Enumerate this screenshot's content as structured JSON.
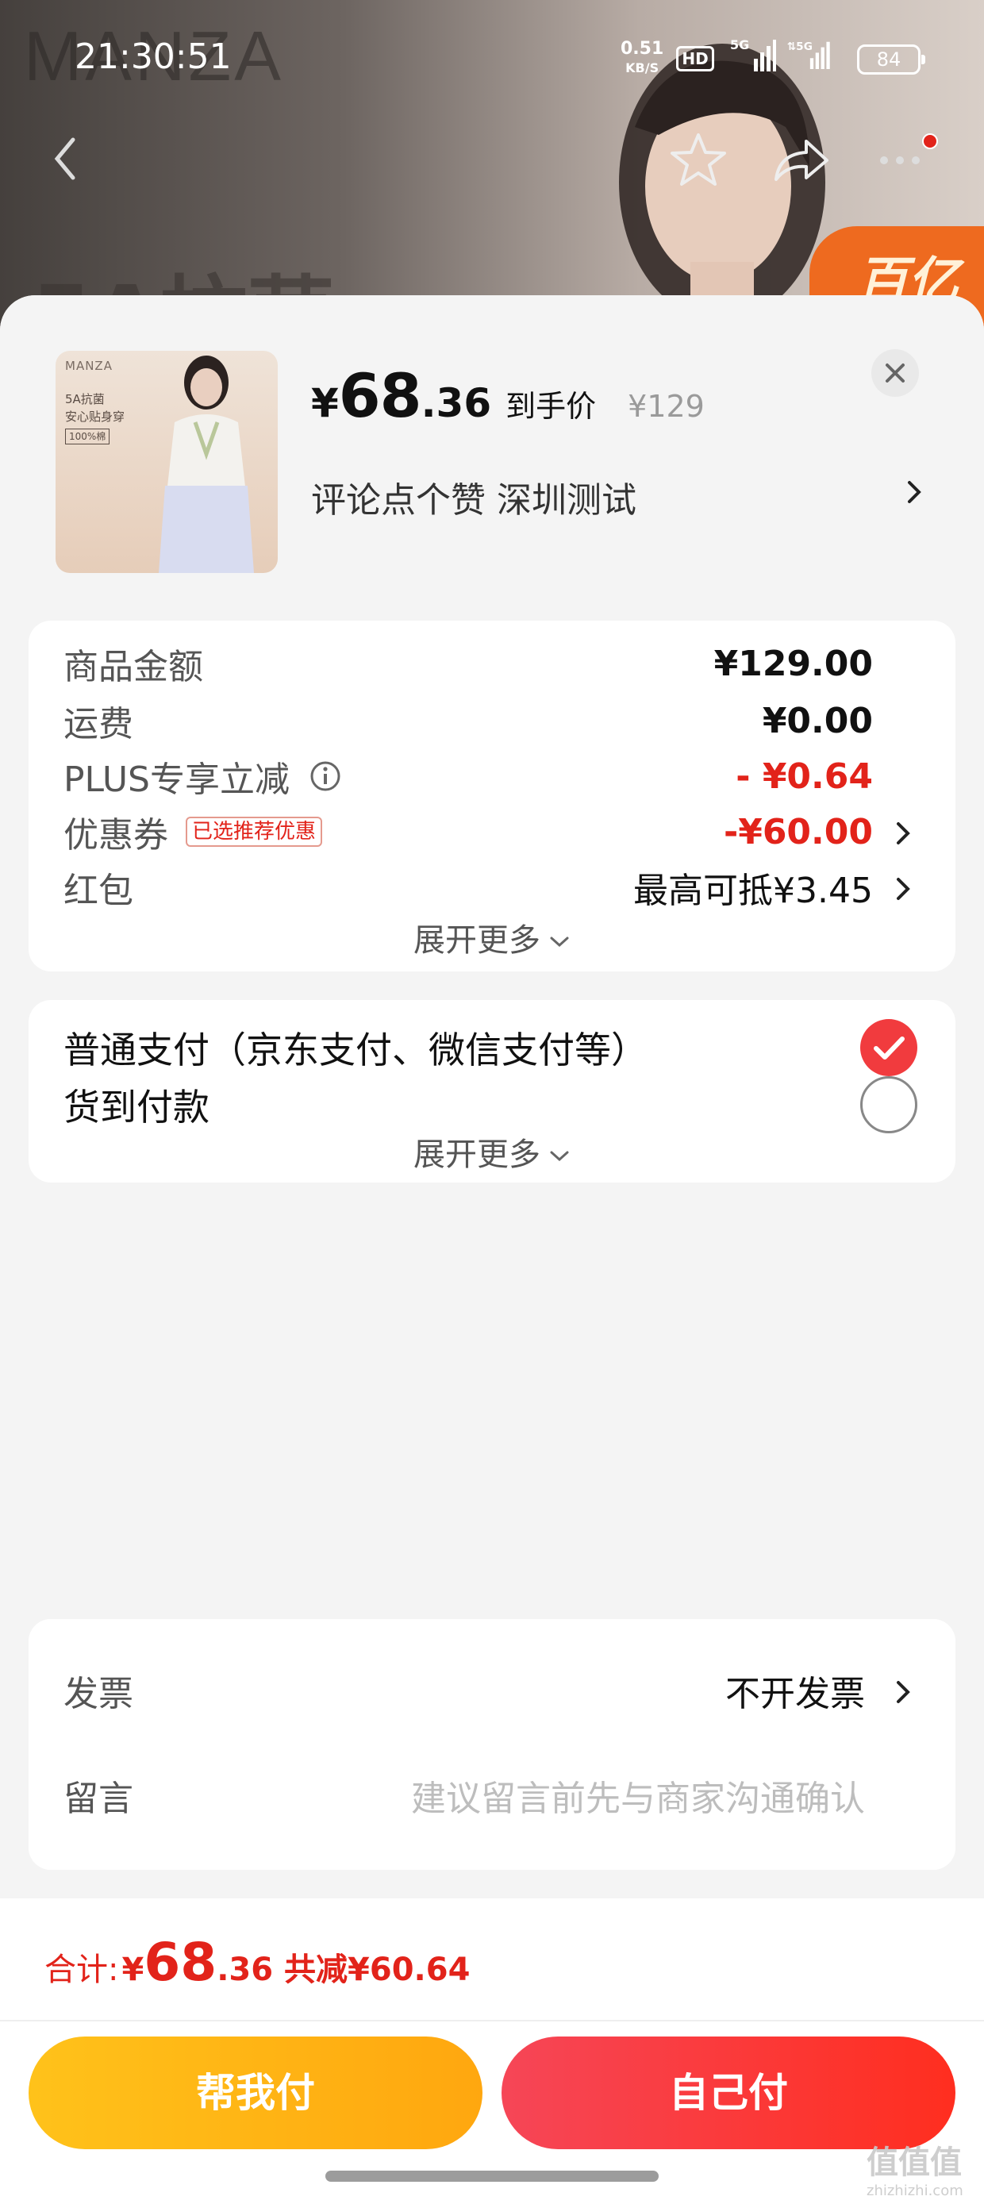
{
  "status_bar": {
    "time": "21:30:51",
    "net_speed": "0.51",
    "net_unit": "KB/S",
    "hd_badge": "HD",
    "signal1_label": "5G",
    "signal2_label": "5G",
    "battery": "84"
  },
  "background": {
    "brand": "MANZA",
    "headline": "5A抗菌",
    "badge_text": "百亿"
  },
  "product": {
    "thumb_brand": "MANZA",
    "thumb_line1": "5A抗菌",
    "thumb_line2": "安心贴身穿",
    "thumb_tag": "100%棉",
    "price_symbol": "¥",
    "price_int": "68",
    "price_dec": ".36",
    "price_label": "到手价",
    "original_price": "¥129",
    "subtitle": "评论点个赞  深圳测试"
  },
  "costs": {
    "goods_label": "商品金额",
    "goods_value": "¥129.00",
    "shipping_label": "运费",
    "shipping_value": "¥0.00",
    "plus_label": "PLUS专享立减",
    "plus_value": "- ¥0.64",
    "coupon_label": "优惠券",
    "coupon_tag": "已选推荐优惠",
    "coupon_value": "-¥60.00",
    "redpacket_label": "红包",
    "redpacket_value": "最高可抵¥3.45",
    "expand": "展开更多"
  },
  "payment": {
    "option1": "普通支付（京东支付、微信支付等）",
    "option2": "货到付款",
    "expand": "展开更多",
    "selected": 1
  },
  "misc": {
    "invoice_label": "发票",
    "invoice_value": "不开发票",
    "message_label": "留言",
    "message_placeholder": "建议留言前先与商家沟通确认"
  },
  "bottom": {
    "total_label": "合计:",
    "total_symbol": "¥",
    "total_int": "68",
    "total_dec": ".36",
    "total_saved": "共减¥60.64",
    "help_pay": "帮我付",
    "self_pay": "自己付",
    "watermark": "值值值",
    "watermark_url": "zhizhizhi.com"
  },
  "colors": {
    "accent_red": "#e2231a",
    "help_btn": "#ffb414",
    "self_btn": "#f8323a"
  }
}
